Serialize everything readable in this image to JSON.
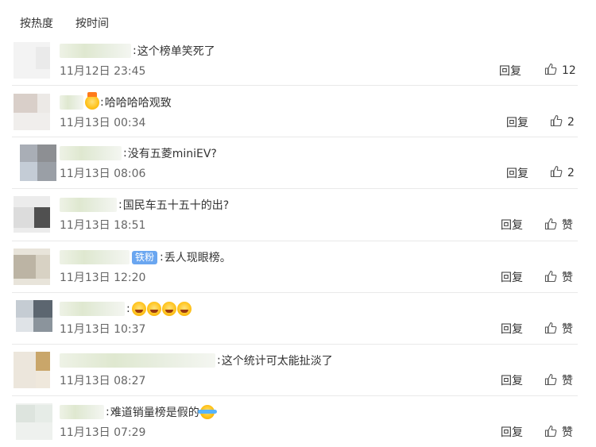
{
  "sort_tabs": {
    "hot": "按热度",
    "time": "按时间"
  },
  "reply_label": "回复",
  "comments": [
    {
      "text": "这个榜单笑死了",
      "time": "11月12日 23:45",
      "like": "12"
    },
    {
      "text": "哈哈哈哈观致",
      "time": "11月13日 00:34",
      "like": "2"
    },
    {
      "text": "没有五菱miniEV?",
      "time": "11月13日 08:06",
      "like": "2"
    },
    {
      "text": "国民车五十五十的出?",
      "time": "11月13日 18:51",
      "like": "赞"
    },
    {
      "badge": "铁粉",
      "text": "丢人现眼榜。",
      "time": "11月13日 12:20",
      "like": "赞"
    },
    {
      "text": "",
      "time": "11月13日 10:37",
      "like": "赞"
    },
    {
      "text": "这个统计可太能扯淡了",
      "time": "11月13日 08:27",
      "like": "赞"
    },
    {
      "text": "难道销量榜是假的",
      "time": "11月13日 07:29",
      "like": "赞"
    }
  ],
  "icons": {
    "thumb": "thumbs-up-icon",
    "crown_emoji": "crown-emoji-icon",
    "grin_emoji": "grin-emoji-icon",
    "cry_emoji": "tears-of-joy-emoji-icon"
  }
}
